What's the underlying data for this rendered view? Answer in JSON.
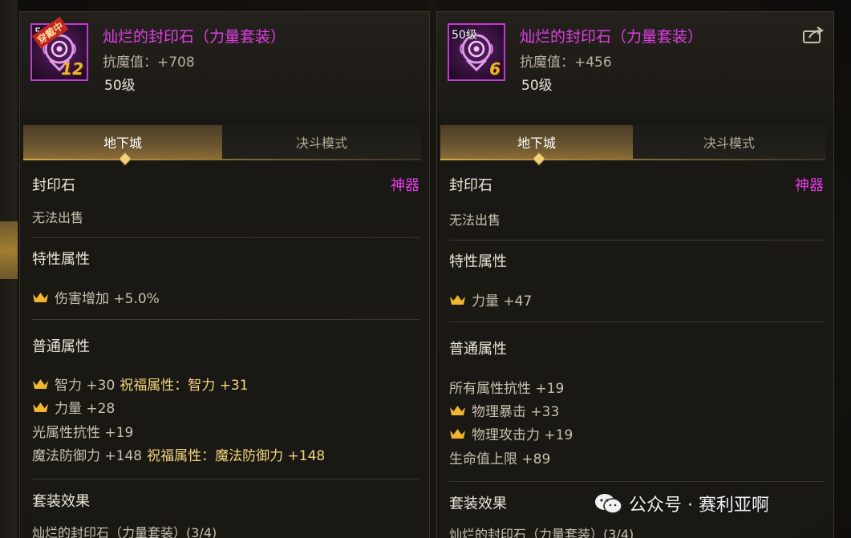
{
  "left_panel": {
    "badge_text": "5",
    "equipped_label": "穿戴中",
    "upgrade": "12",
    "item_name": "灿烂的封印石（力量套装）",
    "resist": "抗魔值：+708",
    "level": "50级",
    "tabs": [
      "地下城",
      "决斗模式"
    ],
    "item_type": "封印石",
    "rarity": "神器",
    "trade_status": "无法出售",
    "trait_title": "特性属性",
    "trait_attrs": [
      {
        "crown": true,
        "text": "伤害增加 +5.0%",
        "bless": ""
      }
    ],
    "normal_title": "普通属性",
    "normal_attrs": [
      {
        "crown": true,
        "text": "智力 +30",
        "bless": "祝福属性：智力 +31"
      },
      {
        "crown": true,
        "text": "力量 +28",
        "bless": ""
      },
      {
        "crown": false,
        "text": "光属性抗性 +19",
        "bless": ""
      },
      {
        "crown": false,
        "text": "魔法防御力 +148",
        "bless": "祝福属性：魔法防御力 +148"
      }
    ],
    "set_title": "套装效果",
    "set_name": "灿烂的封印石（力量套装）(3/4)"
  },
  "right_panel": {
    "badge_text": "50级",
    "upgrade": "6",
    "item_name": "灿烂的封印石（力量套装）",
    "resist": "抗魔值：+456",
    "level": "50级",
    "tabs": [
      "地下城",
      "决斗模式"
    ],
    "item_type": "封印石",
    "rarity": "神器",
    "trade_status": "无法出售",
    "trait_title": "特性属性",
    "trait_attrs": [
      {
        "crown": true,
        "text": "力量 +47",
        "bless": ""
      }
    ],
    "normal_title": "普通属性",
    "normal_attrs": [
      {
        "crown": false,
        "text": "所有属性抗性 +19",
        "bless": ""
      },
      {
        "crown": true,
        "text": "物理暴击 +33",
        "bless": ""
      },
      {
        "crown": true,
        "text": "物理攻击力 +19",
        "bless": ""
      },
      {
        "crown": false,
        "text": "生命值上限 +89",
        "bless": ""
      }
    ],
    "set_title": "套装效果",
    "set_name": "灿烂的封印石（力量套装）(3/4)"
  },
  "watermark": {
    "text": "公众号 · 赛利亚啊"
  },
  "colors": {
    "epic_name": "#e13ee6",
    "bless": "#f6d77c",
    "crown": "#f2b530"
  }
}
